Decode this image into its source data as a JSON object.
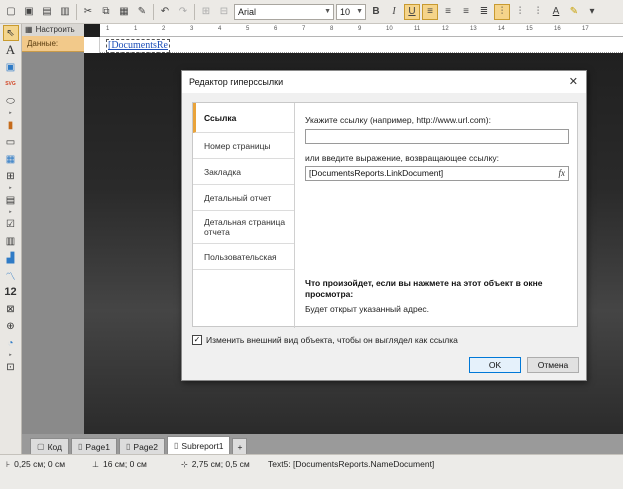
{
  "toolbar": {
    "font_name": "Arial",
    "font_size": "10",
    "bold": "B",
    "italic": "I",
    "underline": "U"
  },
  "band_panel": {
    "setup_label": "Настроить",
    "data_band": "Данные:"
  },
  "design": {
    "field_text": "[DocumentsRe",
    "ruler_marks": [
      "1",
      "1",
      "2",
      "3",
      "4",
      "5",
      "6",
      "7",
      "8",
      "9",
      "10",
      "11",
      "12",
      "13",
      "14",
      "15",
      "16",
      "17"
    ]
  },
  "dialog": {
    "title": "Редактор гиперссылки",
    "tabs": [
      "Ссылка",
      "Номер страницы",
      "Закладка",
      "Детальный отчет",
      "Детальная страница отчета",
      "Пользовательская"
    ],
    "url_label": "Укажите ссылку (например, http://www.url.com):",
    "url_value": "",
    "expr_label": "или введите выражение, возвращающее ссылку:",
    "expr_value": "[DocumentsReports.LinkDocument]",
    "fx": "fx",
    "info_heading": "Что произойдет, если вы нажмете на этот объект в окне просмотра:",
    "info_text": "Будет открыт указанный адрес.",
    "checkbox_label": "Изменить внешний вид объекта, чтобы он выглядел как ссылка",
    "ok": "OK",
    "cancel": "Отмена"
  },
  "tabs": [
    "Код",
    "Page1",
    "Page2",
    "Subreport1"
  ],
  "status": {
    "pos": "0,25 см; 0 см",
    "size": "16 см; 0 см",
    "pos2": "2,75 см; 0,5 см",
    "object": "Text5:  [DocumentsReports.NameDocument]"
  }
}
